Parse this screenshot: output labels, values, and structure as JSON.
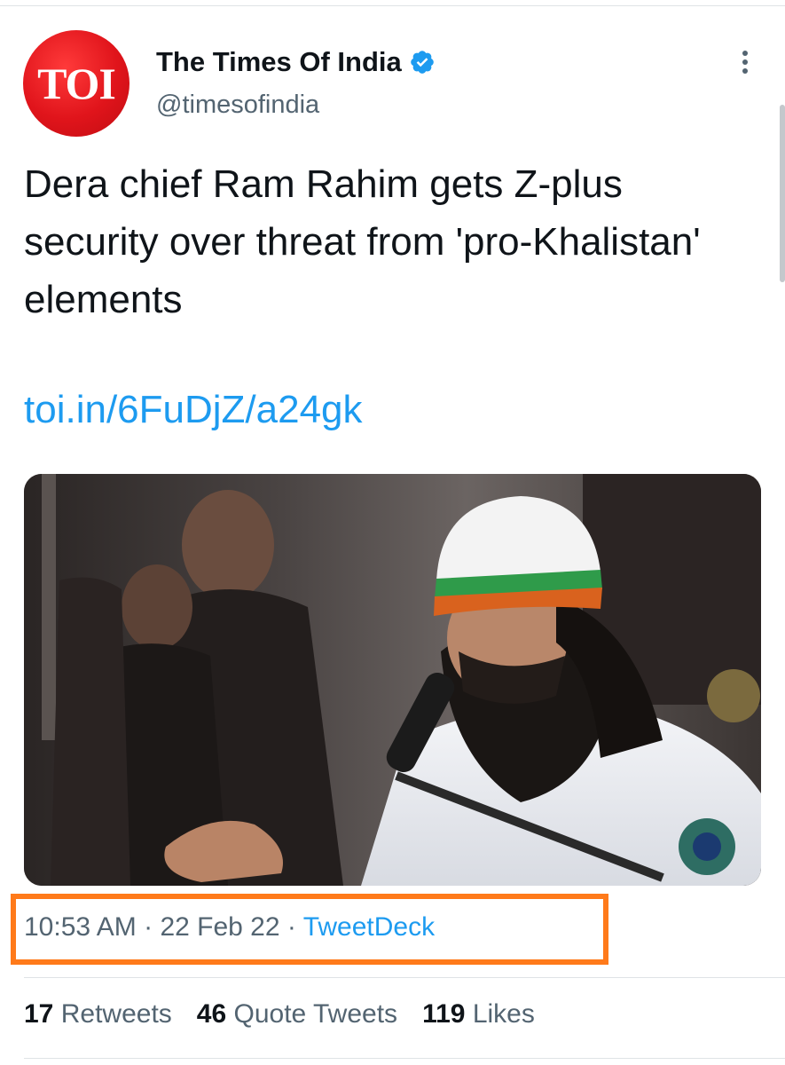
{
  "account": {
    "avatar_text": "TOI",
    "display_name": "The Times Of India",
    "handle": "@timesofindia",
    "verified": true
  },
  "tweet": {
    "text": "Dera chief Ram Rahim gets Z-plus security over threat from 'pro-Khalistan' elements",
    "link": "toi.in/6FuDjZ/a24gk"
  },
  "meta": {
    "time": "10:53 AM",
    "separator": "·",
    "date": "22 Feb 22",
    "source": "TweetDeck"
  },
  "stats": {
    "retweets_count": "17",
    "retweets_label": "Retweets",
    "quotes_count": "46",
    "quotes_label": "Quote Tweets",
    "likes_count": "119",
    "likes_label": "Likes"
  },
  "icons": {
    "verified": "verified-badge-icon",
    "more": "more-vertical-icon"
  },
  "colors": {
    "link": "#1d9bf0",
    "secondary_text": "#536471",
    "highlight": "#ff7a1a",
    "avatar": "#e0141b"
  }
}
